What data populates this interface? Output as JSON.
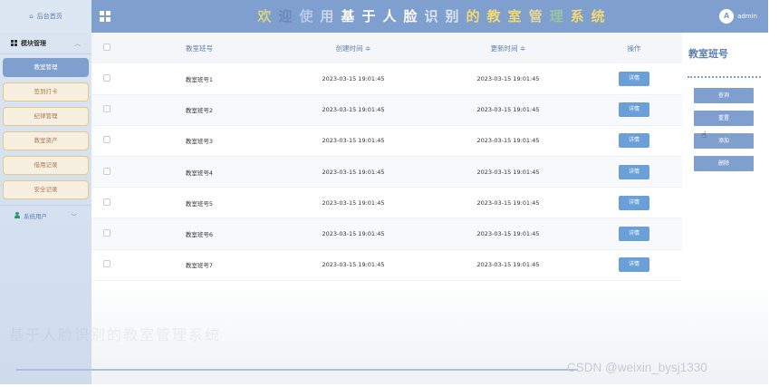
{
  "header": {
    "home_label": "后台首页",
    "title_parts": [
      {
        "text": "欢",
        "color": "#d4d18a"
      },
      {
        "text": "迎",
        "color": "#6a8ac0"
      },
      {
        "text": "使",
        "color": "#b7c9e6"
      },
      {
        "text": "用",
        "color": "#c7d5ea"
      },
      {
        "text": "基",
        "color": "#ffffff"
      },
      {
        "text": "于",
        "color": "#ffffff"
      },
      {
        "text": "人",
        "color": "#ffffff"
      },
      {
        "text": "脸",
        "color": "#ffffff"
      },
      {
        "text": "识",
        "color": "#dde6f3"
      },
      {
        "text": "别",
        "color": "#dde6f3"
      },
      {
        "text": "的",
        "color": "#f0d873"
      },
      {
        "text": "教",
        "color": "#f0d873"
      },
      {
        "text": "室",
        "color": "#f0d873"
      },
      {
        "text": "管",
        "color": "#e6d59a"
      },
      {
        "text": "理",
        "color": "#98c4a4"
      },
      {
        "text": "系",
        "color": "#f0d873"
      },
      {
        "text": "统",
        "color": "#f0d873"
      }
    ],
    "user": "admin",
    "avatar_text": "A"
  },
  "sidebar": {
    "module_label": "模块管理",
    "items": [
      {
        "label": "教室管理",
        "active": true
      },
      {
        "label": "签到打卡",
        "active": false
      },
      {
        "label": "纪律管理",
        "active": false
      },
      {
        "label": "教室资产",
        "active": false
      },
      {
        "label": "借用记录",
        "active": false
      },
      {
        "label": "安全记录",
        "active": false
      }
    ],
    "users_label": "系统用户"
  },
  "table": {
    "headers": [
      "教室班号",
      "创建时间 ≑",
      "更新时间 ≑",
      "操作"
    ],
    "rows": [
      {
        "name": "教室班号1",
        "created": "2023-03-15 19:01:45",
        "updated": "2023-03-15 19:01:45",
        "action": "详情"
      },
      {
        "name": "教室班号2",
        "created": "2023-03-15 19:01:45",
        "updated": "2023-03-15 19:01:45",
        "action": "详情"
      },
      {
        "name": "教室班号3",
        "created": "2023-03-15 19:01:45",
        "updated": "2023-03-15 19:01:45",
        "action": "详情"
      },
      {
        "name": "教室班号4",
        "created": "2023-03-15 19:01:45",
        "updated": "2023-03-15 19:01:45",
        "action": "详情"
      },
      {
        "name": "教室班号5",
        "created": "2023-03-15 19:01:45",
        "updated": "2023-03-15 19:01:45",
        "action": "详情"
      },
      {
        "name": "教室班号6",
        "created": "2023-03-15 19:01:45",
        "updated": "2023-03-15 19:01:45",
        "action": "详情"
      },
      {
        "name": "教室班号7",
        "created": "2023-03-15 19:01:45",
        "updated": "2023-03-15 19:01:45",
        "action": "详情"
      }
    ]
  },
  "search_panel": {
    "title": "教室班号",
    "buttons": [
      "查询",
      "重置",
      "添加",
      "删除"
    ]
  },
  "footer": {
    "ghost_text": "基于人脸识别的教室管理系统",
    "watermark": "CSDN @weixin_bysj1330"
  },
  "colors": {
    "accent": "#7f9fce",
    "detail_button": "#6a9fd8",
    "menu_border": "#e6c98a"
  }
}
